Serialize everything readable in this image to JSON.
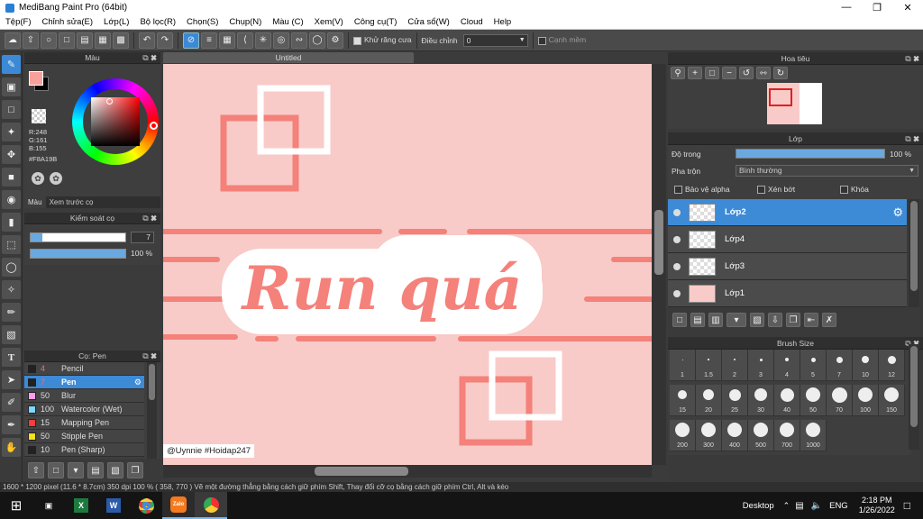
{
  "window": {
    "title": "MediBang Paint Pro (64bit)"
  },
  "menu": [
    "Tệp(F)",
    "Chỉnh sửa(E)",
    "Lớp(L)",
    "Bộ lọc(R)",
    "Chọn(S)",
    "Chụp(N)",
    "Màu (C)",
    "Xem(V)",
    "Công cụ(T)",
    "Cửa sổ(W)",
    "Cloud",
    "Help"
  ],
  "toolbar": {
    "antialias_label": "Khử răng cưa",
    "adjust_label": "Điều chỉnh",
    "adjust_value": "0",
    "edge_label": "Cạnh mềm"
  },
  "color_panel": {
    "title": "Màu",
    "r": "R:248",
    "g": "G:161",
    "b": "B:155",
    "hex": "#F8A19B",
    "tab_color": "Màu",
    "tab_preview": "Xem trước cọ",
    "fg_color": "#F8A19B"
  },
  "brush_control": {
    "title": "Kiểm soát cọ",
    "size": "7",
    "opacity": "100 %"
  },
  "brush_panel": {
    "title": "Cọ: Pen",
    "items": [
      {
        "size": "4",
        "name": "Pencil",
        "color": "#222222",
        "size_color": "#ff6a6a"
      },
      {
        "size": "7",
        "name": "Pen",
        "color": "#222222",
        "size_color": "#ff6a6a"
      },
      {
        "size": "50",
        "name": "Blur",
        "color": "#ff9ee8",
        "size_color": "#dddddd"
      },
      {
        "size": "100",
        "name": "Watercolor (Wet)",
        "color": "#7fd6ff",
        "size_color": "#dddddd"
      },
      {
        "size": "15",
        "name": "Mapping Pen",
        "color": "#ff3b3b",
        "size_color": "#dddddd"
      },
      {
        "size": "50",
        "name": "Stipple Pen",
        "color": "#f3e21a",
        "size_color": "#dddddd"
      },
      {
        "size": "10",
        "name": "Pen (Sharp)",
        "color": "#222222",
        "size_color": "#dddddd"
      }
    ]
  },
  "canvas": {
    "tab": "Untitled",
    "text": "Run quá",
    "credit": "@Uynnie #Hoidap247",
    "bg_color": "#F8CBC8",
    "accent_color": "#F4817A"
  },
  "navigator": {
    "title": "Hoa tiêu"
  },
  "layer_panel": {
    "title": "Lớp",
    "opacity_label": "Độ trong",
    "opacity_value": "100 %",
    "opacity_level": 1.0,
    "blend_label": "Pha trộn",
    "blend_value": "Bình thường",
    "opt_alpha": "Bảo vệ alpha",
    "opt_clip": "Xén bớt",
    "opt_lock": "Khóa",
    "layers": [
      "Lớp2",
      "Lớp4",
      "Lớp3",
      "Lớp1"
    ]
  },
  "brush_size": {
    "title": "Brush Size",
    "sizes": [
      "1",
      "1.5",
      "2",
      "3",
      "4",
      "5",
      "7",
      "10",
      "12",
      "15",
      "20",
      "25",
      "30",
      "40",
      "50",
      "70",
      "100",
      "150",
      "200",
      "300",
      "400",
      "500",
      "700",
      "1000"
    ]
  },
  "status": "1600 * 1200 pixel   (11.6 * 8.7cm)  350 dpi   100 %   ( 358, 770 )   Vẽ một đường thẳng bằng cách giữ phím Shift, Thay đổi cỡ cọ bằng cách giữ phím Ctrl, Alt và kéo",
  "taskbar": {
    "desktop": "Desktop",
    "lang": "ENG",
    "time": "2:18 PM",
    "date": "1/26/2022"
  }
}
